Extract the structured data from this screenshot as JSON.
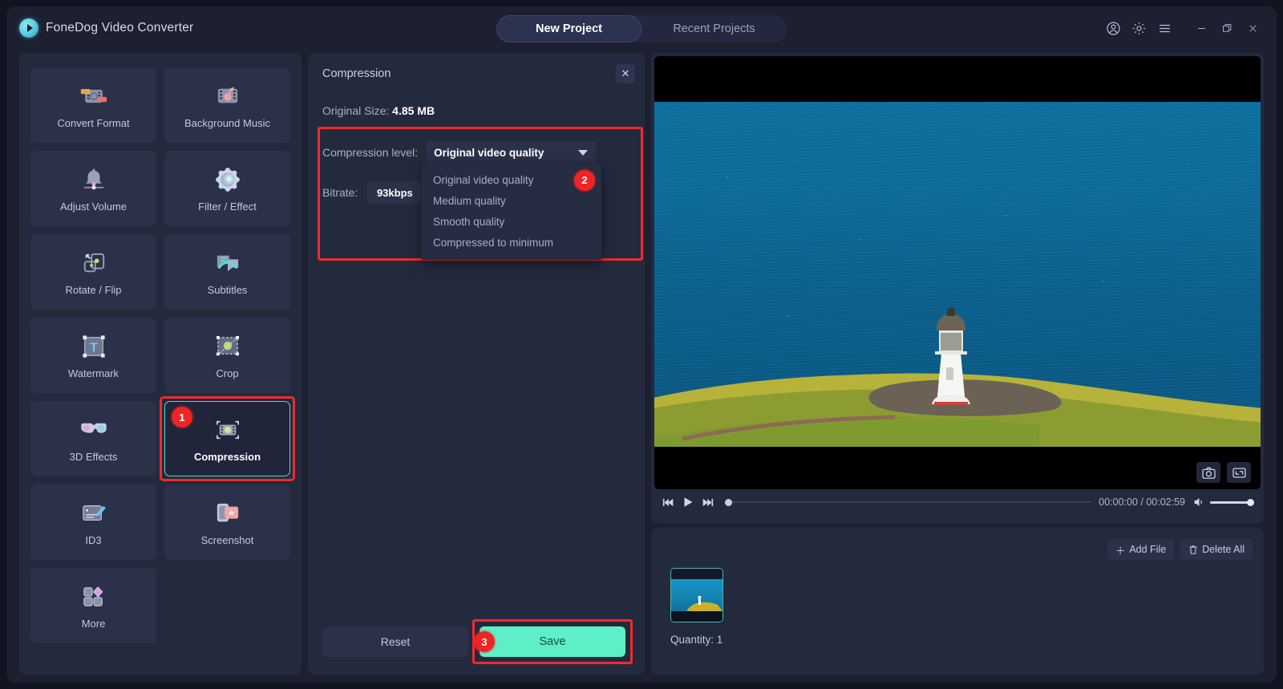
{
  "app": {
    "brand": "FoneDog Video Converter",
    "logo_icon": "play-circle-icon"
  },
  "titlebar": {
    "tabs": [
      {
        "label": "New Project",
        "active": true
      },
      {
        "label": "Recent Projects",
        "active": false
      }
    ],
    "icons": [
      {
        "name": "account-icon"
      },
      {
        "name": "gear-icon"
      },
      {
        "name": "hamburger-menu-icon"
      },
      {
        "name": "minimize-icon"
      },
      {
        "name": "maximize-icon"
      },
      {
        "name": "close-icon"
      }
    ]
  },
  "sidebar": {
    "tools": [
      {
        "label": "Convert Format",
        "icon": "convert-format-icon",
        "selected": false
      },
      {
        "label": "Background Music",
        "icon": "background-music-icon",
        "selected": false
      },
      {
        "label": "Adjust Volume",
        "icon": "adjust-volume-icon",
        "selected": false
      },
      {
        "label": "Filter / Effect",
        "icon": "filter-effect-icon",
        "selected": false
      },
      {
        "label": "Rotate / Flip",
        "icon": "rotate-flip-icon",
        "selected": false
      },
      {
        "label": "Subtitles",
        "icon": "subtitles-icon",
        "selected": false
      },
      {
        "label": "Watermark",
        "icon": "watermark-icon",
        "selected": false
      },
      {
        "label": "Crop",
        "icon": "crop-icon",
        "selected": false
      },
      {
        "label": "3D Effects",
        "icon": "3d-effects-icon",
        "selected": false
      },
      {
        "label": "Compression",
        "icon": "compression-icon",
        "selected": true,
        "badge": "1"
      },
      {
        "label": "ID3",
        "icon": "id3-icon",
        "selected": false
      },
      {
        "label": "Screenshot",
        "icon": "screenshot-icon",
        "selected": false
      },
      {
        "label": "More",
        "icon": "more-icon",
        "selected": false
      }
    ]
  },
  "compression_panel": {
    "title": "Compression",
    "close_icon": "close-icon",
    "original_size_label": "Original Size:",
    "original_size_value": "4.85 MB",
    "level_label": "Compression level:",
    "level_value": "Original video quality",
    "level_options": [
      "Original video quality",
      "Medium quality",
      "Smooth quality",
      "Compressed to minimum"
    ],
    "dropdown_badge": "2",
    "bitrate_label": "Bitrate:",
    "bitrate_value": "93kbps",
    "reset_label": "Reset",
    "save_label": "Save",
    "save_badge": "3"
  },
  "player": {
    "prev_icon": "skip-previous-icon",
    "play_icon": "play-icon",
    "next_icon": "skip-next-icon",
    "current_time": "00:00:00",
    "total_time": "00:02:59",
    "time_display": "00:00:00 / 00:02:59",
    "volume_icon": "volume-icon",
    "snapshot_icon": "camera-icon",
    "fullscreen_icon": "fullscreen-icon"
  },
  "files": {
    "add_file_label": "Add File",
    "add_file_icon": "plus-icon",
    "delete_all_label": "Delete All",
    "delete_all_icon": "trash-icon",
    "quantity_label": "Quantity: 1",
    "thumbnail_name": "lighthouse-thumbnail"
  },
  "colors": {
    "window_bg": "#1c2031",
    "panel_bg": "#242a3d",
    "card_bg": "#2b3148",
    "accent_green": "#5df0c8",
    "accent_teal": "#5ad6c8",
    "highlight_red": "#ee2b2b",
    "badge_red": "#f02424",
    "text_primary": "#ffffff",
    "text_secondary": "#aab2c8"
  }
}
